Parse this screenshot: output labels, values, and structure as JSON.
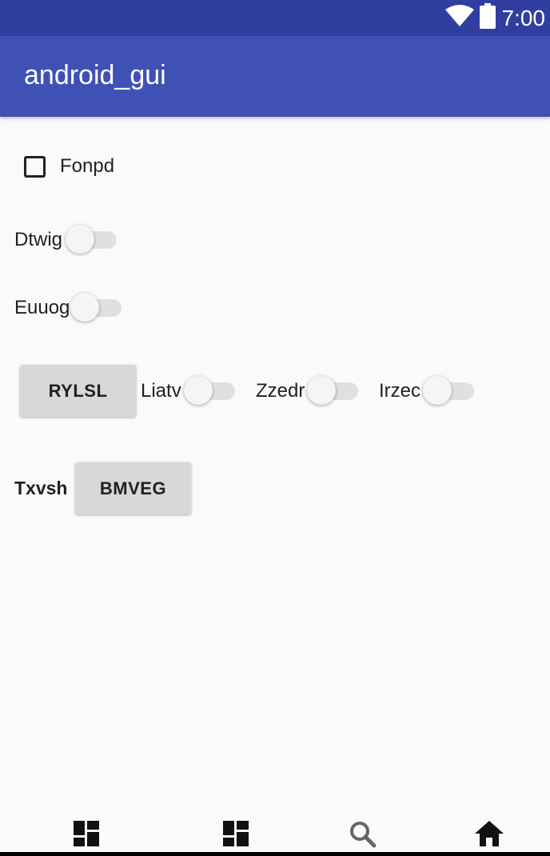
{
  "status_bar": {
    "time": "7:00"
  },
  "app_bar": {
    "title": "android_gui"
  },
  "checkbox": {
    "label": "Fonpd",
    "checked": false
  },
  "switches": [
    {
      "label": "Dtwig",
      "on": false
    },
    {
      "label": "Euuog",
      "on": false
    },
    {
      "label": "Liatv",
      "on": false
    },
    {
      "label": "Zzedr",
      "on": false
    },
    {
      "label": "Irzec",
      "on": false
    }
  ],
  "buttons": {
    "rylsl": "RYLSL",
    "bmveg": "BMVEG"
  },
  "text_label": "Txvsh",
  "bottom_nav": {
    "items": [
      {
        "icon": "dashboard-icon"
      },
      {
        "icon": "dashboard-icon"
      },
      {
        "icon": "search-icon"
      },
      {
        "icon": "home-icon"
      }
    ]
  }
}
